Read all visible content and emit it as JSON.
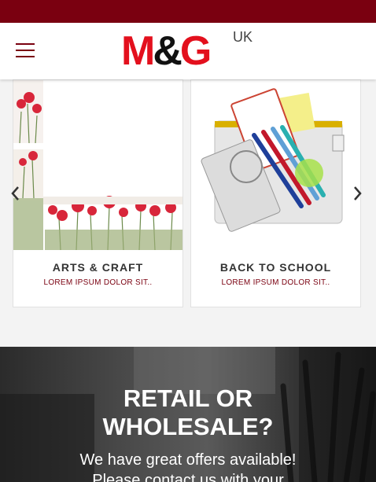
{
  "brand": {
    "logo_text": "M&G",
    "logo_region": "UK",
    "primary_color": "#7a0010",
    "logo_red": "#e3101d"
  },
  "header": {
    "menu_icon": "hamburger-menu-icon"
  },
  "categories": [
    {
      "title": "ARTS & CRAFT",
      "subtitle": "LOREM IPSUM DOLOR SIT.."
    },
    {
      "title": "BACK TO SCHOOL",
      "subtitle": "LOREM IPSUM DOLOR SIT.."
    }
  ],
  "carousel": {
    "prev_icon": "chevron-left-icon",
    "next_icon": "chevron-right-icon"
  },
  "promo": {
    "heading_line1": "RETAIL OR",
    "heading_line2": "WHOLESALE?",
    "text_line1": "We have great offers available!",
    "text_line2": "Please contact us with your"
  }
}
